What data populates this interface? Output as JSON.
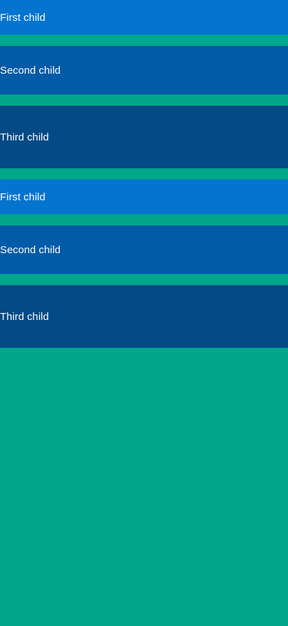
{
  "groups": [
    {
      "items": [
        {
          "label": "First child",
          "color": "#0474cf"
        },
        {
          "label": "Second child",
          "color": "#035aa6"
        },
        {
          "label": "Third child",
          "color": "#034a86"
        }
      ]
    },
    {
      "items": [
        {
          "label": "First child",
          "color": "#0474cf"
        },
        {
          "label": "Second child",
          "color": "#035aa6"
        },
        {
          "label": "Third child",
          "color": "#034a86"
        }
      ]
    }
  ],
  "colors": {
    "background": "#00a78a",
    "first": "#0474cf",
    "second": "#035aa6",
    "third": "#034a86",
    "text": "#ffffff"
  }
}
